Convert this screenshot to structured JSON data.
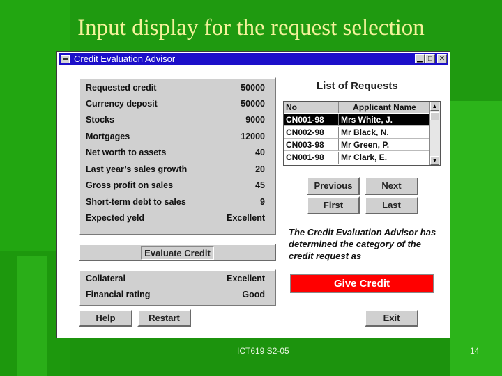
{
  "slide": {
    "title": "Input display for the request selection",
    "footer_text": "ICT619 S2-05",
    "page_number": "14"
  },
  "window": {
    "title": "Credit Evaluation Advisor",
    "minimize_glyph": "▁",
    "maximize_glyph": "□",
    "close_glyph": "✕"
  },
  "inputs": [
    {
      "label": "Requested credit",
      "value": "50000"
    },
    {
      "label": "Currency deposit",
      "value": "50000"
    },
    {
      "label": "Stocks",
      "value": "9000"
    },
    {
      "label": "Mortgages",
      "value": "12000"
    },
    {
      "label": "Net worth to assets",
      "value": "40"
    },
    {
      "label": "Last year’s sales growth",
      "value": "20"
    },
    {
      "label": "Gross profit on sales",
      "value": "45"
    },
    {
      "label": "Short-term debt to sales",
      "value": "9"
    },
    {
      "label": "Expected yeld",
      "value": "Excellent"
    }
  ],
  "evaluate_button": "Evaluate Credit",
  "outputs": [
    {
      "label": "Collateral",
      "value": "Excellent"
    },
    {
      "label": "Financial rating",
      "value": "Good"
    }
  ],
  "help_button": "Help",
  "restart_button": "Restart",
  "requests": {
    "heading": "List of Requests",
    "columns": [
      "No",
      "Applicant Name"
    ],
    "rows": [
      {
        "no": "CN001-98",
        "name": "Mrs White, J.",
        "selected": true
      },
      {
        "no": "CN002-98",
        "name": "Mr Black, N.",
        "selected": false
      },
      {
        "no": "CN003-98",
        "name": "Mr Green, P.",
        "selected": false
      },
      {
        "no": "CN001-98",
        "name": "Mr Clark, E.",
        "selected": false
      }
    ]
  },
  "nav_buttons": {
    "previous": "Previous",
    "next": "Next",
    "first": "First",
    "last": "Last"
  },
  "advisor_text": "The Credit  Evaluation  Advisor has determined the category of the credit request as",
  "result": "Give Credit",
  "exit_button": "Exit",
  "colors": {
    "background": "#1f9a10",
    "title_bar": "#1c0fc9",
    "result_bg": "#ff0000",
    "title_text": "#f4f29a"
  }
}
